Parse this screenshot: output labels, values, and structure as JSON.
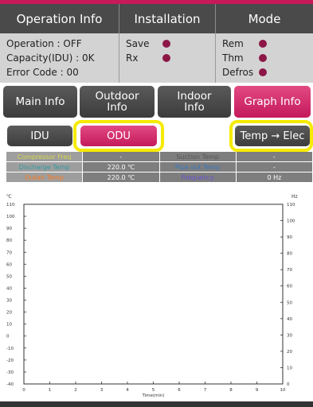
{
  "header": {
    "operation_info": "Operation Info",
    "installation": "Installation",
    "mode": "Mode"
  },
  "status": {
    "operation": "Operation : OFF",
    "capacity": "Capacity(IDU) : 0K",
    "error_code": "Error Code : 00",
    "save": "Save",
    "rx": "Rx",
    "rem": "Rem",
    "thm": "Thm",
    "defros": "Defros",
    "led_color": "#8c1747"
  },
  "tabs": [
    {
      "label": "Main Info"
    },
    {
      "label": "Outdoor Info"
    },
    {
      "label": "Indoor Info"
    },
    {
      "label": "Graph Info",
      "active": true
    }
  ],
  "sub_buttons": {
    "idu": "IDU",
    "odu": "ODU",
    "temp_elec": "Temp → Elec"
  },
  "data_table": {
    "rows": [
      {
        "l1": "Compressor Freq",
        "l1_color": "#d5d84a",
        "v1": "-",
        "l2": "Suction Temp",
        "l2_color": "#555555",
        "v2": "-"
      },
      {
        "l1": "Discharge Temp",
        "l1_color": "#2f9aa3",
        "v1": "220.0 ℃",
        "l2": "Pipe out Temp",
        "l2_color": "#3a78c2",
        "v2": "-"
      },
      {
        "l1": "Outair Temp",
        "l1_color": "#ff7a1c",
        "v1": "220.0 ℃",
        "l2": "Frequency",
        "l2_color": "#6a4fd8",
        "v2": "0 Hz"
      }
    ]
  },
  "chart_data": {
    "type": "line",
    "xlabel": "Time(min)",
    "left_unit": "℃",
    "right_unit": "Hz",
    "xlim": [
      0,
      10
    ],
    "x_ticks": [
      "0",
      "1",
      "2",
      "3",
      "4",
      "5",
      "6",
      "7",
      "8",
      "9",
      "10"
    ],
    "left_ylim": [
      -40,
      110
    ],
    "left_ticks": [
      "110",
      "100",
      "90",
      "80",
      "70",
      "60",
      "50",
      "40",
      "30",
      "20",
      "10",
      "0",
      "-10",
      "-20",
      "-30",
      "-40"
    ],
    "right_ylim": [
      0,
      110
    ],
    "right_ticks": [
      "110",
      "100",
      "90",
      "80",
      "70",
      "60",
      "50",
      "40",
      "30",
      "20",
      "10",
      "0"
    ],
    "series": []
  }
}
